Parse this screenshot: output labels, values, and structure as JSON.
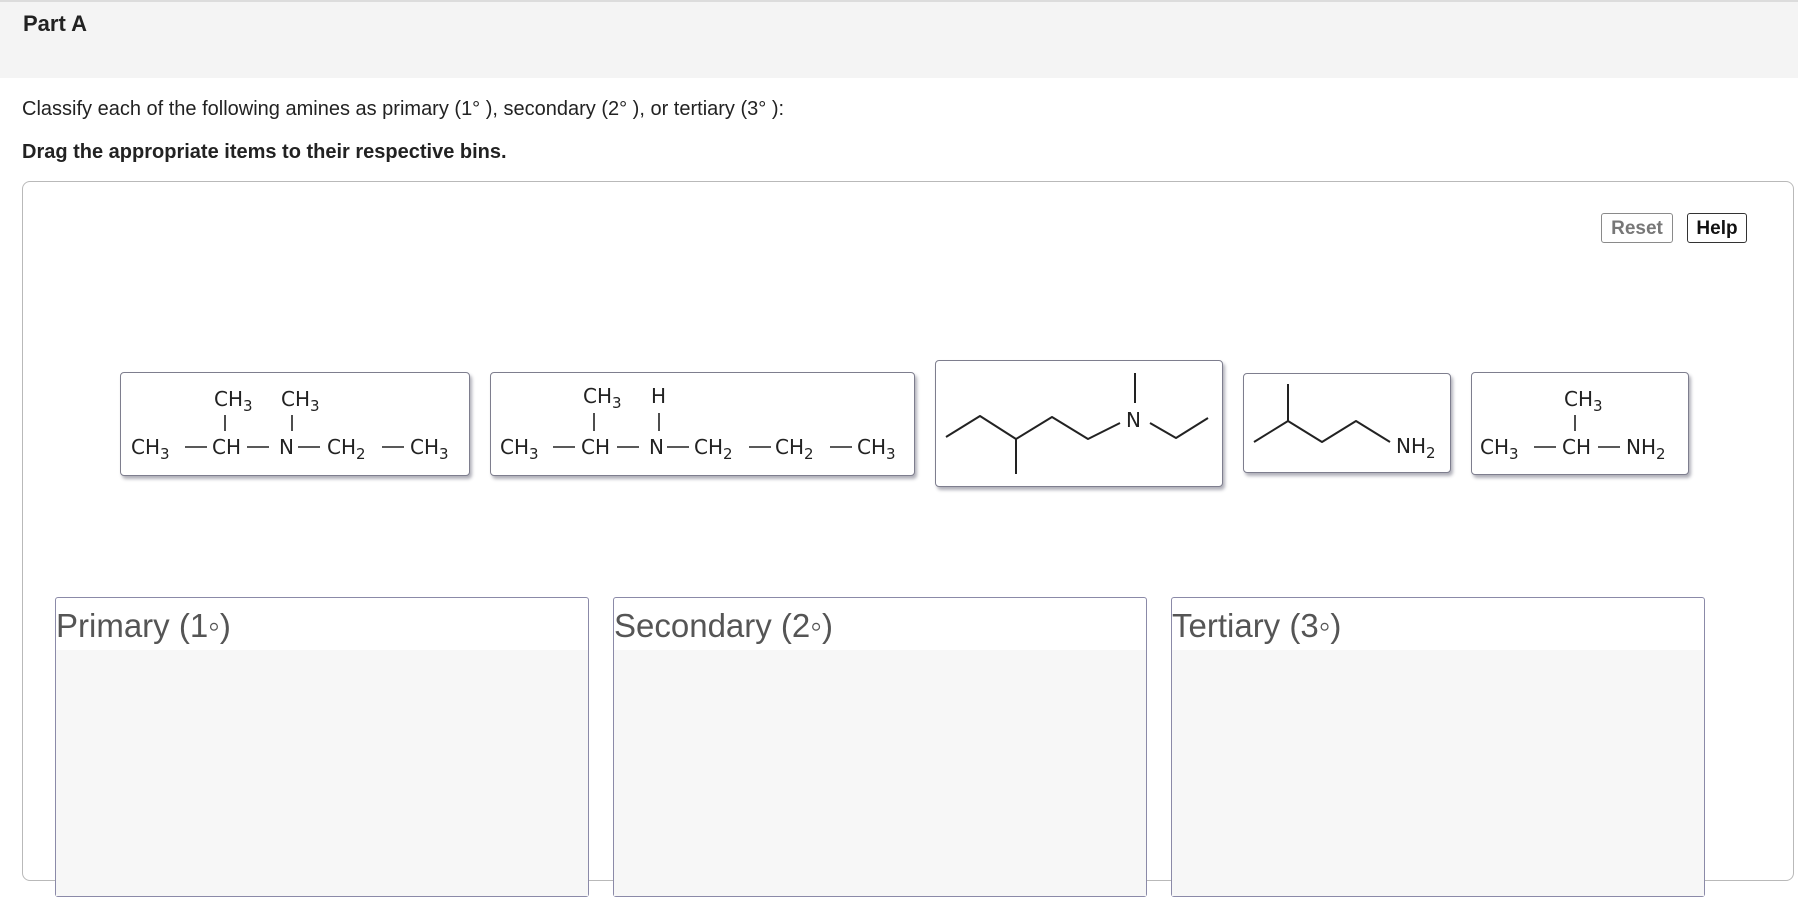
{
  "part": {
    "title": "Part A"
  },
  "prompt": {
    "instruction": "Classify each of the following amines as primary (1° ), secondary (2° ), or tertiary (3° ):",
    "sub_instruction": "Drag the appropriate items to their respective bins."
  },
  "controls": {
    "reset_label": "Reset",
    "help_label": "Help"
  },
  "items": [
    {
      "top": [
        "CH3",
        "CH3"
      ],
      "bottom": [
        "CH3",
        "CH",
        "N",
        "CH2",
        "CH3"
      ]
    },
    {
      "top": [
        "CH3",
        "H"
      ],
      "bottom": [
        "CH3",
        "CH",
        "N",
        "CH2",
        "CH2",
        "CH3"
      ]
    },
    {
      "atom": "N"
    },
    {
      "atom": "NH2"
    },
    {
      "top": [
        "CH3"
      ],
      "bottom": [
        "CH3",
        "CH",
        "NH2"
      ]
    }
  ],
  "bins": [
    {
      "label": "Primary (1◦)"
    },
    {
      "label": "Secondary (2◦)"
    },
    {
      "label": "Tertiary (3◦)"
    }
  ]
}
